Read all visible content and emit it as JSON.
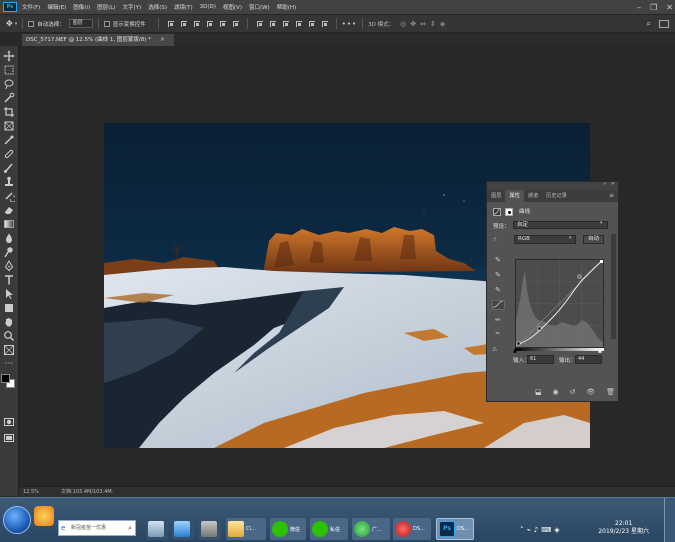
{
  "app": {
    "logo": "Ps"
  },
  "menu": [
    "文件(F)",
    "编辑(E)",
    "图像(I)",
    "图层(L)",
    "文字(Y)",
    "选择(S)",
    "滤镜(T)",
    "3D(D)",
    "视图(V)",
    "窗口(W)",
    "帮助(H)"
  ],
  "options": {
    "auto_select_label": "自动选择：",
    "auto_select_value": "图层",
    "show_transform_label": "显示变换控件",
    "mode_3d_label": "3D 模式："
  },
  "document": {
    "tab_title": "DSC_5717.NEF @ 12.5% (曲线 1, 图层蒙版/8) *",
    "zoom": "12.5%",
    "doc_info": "文档:103.4M/103.4M"
  },
  "panel": {
    "tabs": [
      "图层",
      "属性",
      "通道",
      "历史记录"
    ],
    "active_tab": "属性",
    "layer_name": "曲线",
    "preset_label": "预设：",
    "preset_value": "自定",
    "channel_value": "RGB",
    "auto_button": "自动",
    "input_label": "输入：",
    "input_value": "61",
    "output_label": "输出：",
    "output_value": "44"
  },
  "taskbar": {
    "search_placeholder": "新冠疫苗一优惠",
    "items": [
      "C\\...",
      "微信",
      "私信",
      "广...",
      "DS...",
      "DS..."
    ],
    "time": "22:01",
    "date": "2019/2/23 星期六"
  },
  "colors": {
    "accent": "#2fa3f7",
    "panel_bg": "#535353",
    "app_bg": "#282828"
  }
}
